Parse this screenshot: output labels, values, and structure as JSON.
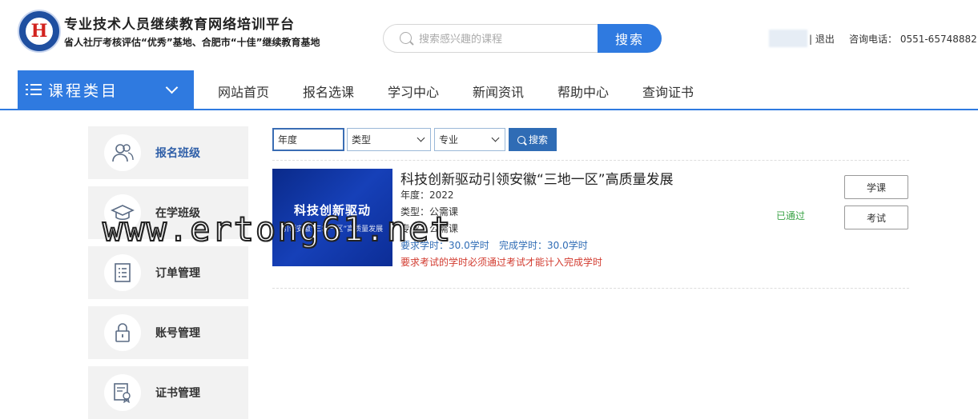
{
  "header": {
    "site_title": "专业技术人员继续教育网络培训平台",
    "site_subtitle": "省人社厅考核评估“优秀”基地、合肥市“十佳”继续教育基地",
    "logo_char": "H",
    "search_placeholder": "搜索感兴趣的课程",
    "search_button": "搜索",
    "logout": "| 退出",
    "hotline": "咨询电话：  0551-65748882"
  },
  "nav": {
    "category_label": "课程类目",
    "items": [
      "网站首页",
      "报名选课",
      "学习中心",
      "新闻资讯",
      "帮助中心",
      "查询证书"
    ]
  },
  "sidebar": {
    "items": [
      {
        "label": "报名班级",
        "icon": "users-icon"
      },
      {
        "label": "在学班级",
        "icon": "graduation-cap-icon"
      },
      {
        "label": "订单管理",
        "icon": "list-doc-icon"
      },
      {
        "label": "账号管理",
        "icon": "lock-icon"
      },
      {
        "label": "证书管理",
        "icon": "certificate-icon"
      }
    ]
  },
  "filters": {
    "year_placeholder": "年度",
    "type_value": "类型",
    "major_value": "专业",
    "search_button": "搜索"
  },
  "course": {
    "image_title": "科技创新驱动",
    "image_subtitle": "引领安徽“三地一区”高质量发展",
    "title": "科技创新驱动引领安徽“三地一区”高质量发展",
    "year": "年度：2022",
    "type": "类型：公需课",
    "major": "专业：公需课",
    "required_hours": "要求学时：30.0学时",
    "completed_hours": "完成学时：30.0学时",
    "exam_note": "要求考试的学时必须通过考试才能计入完成学时",
    "status": "已通过",
    "study_button": "学课",
    "exam_button": "考试"
  },
  "watermark": "www.ertong61.net",
  "colors": {
    "accent": "#2f7ae0",
    "pass_green": "#3aa346",
    "note_red": "#d23b2f"
  }
}
